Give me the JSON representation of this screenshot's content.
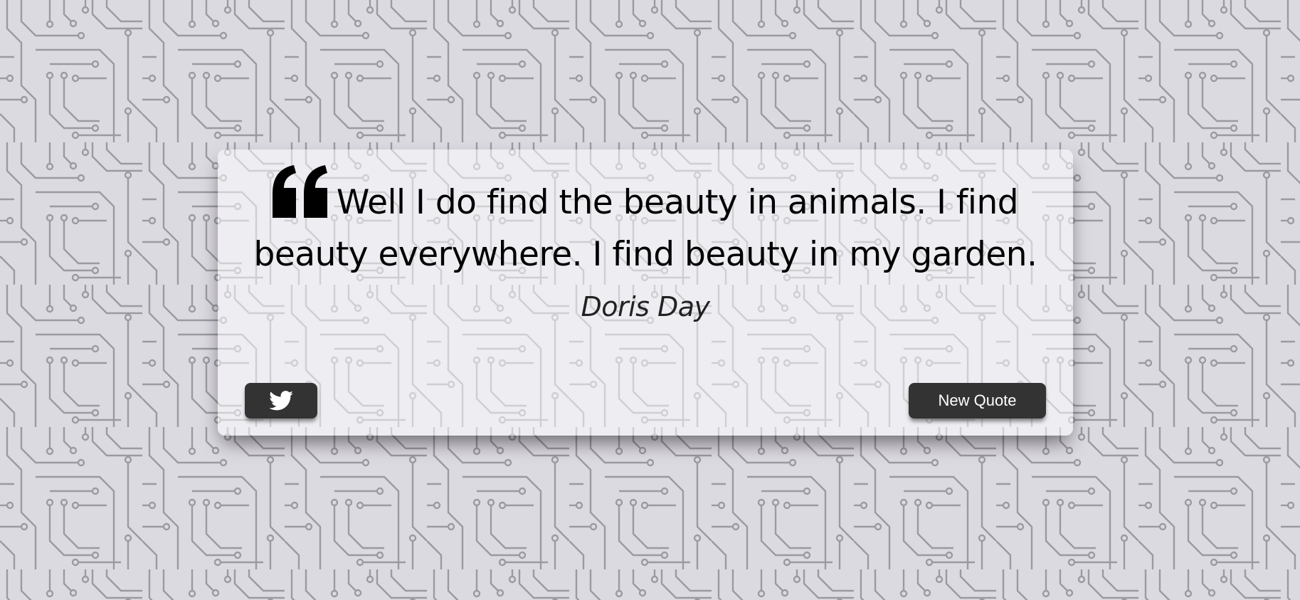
{
  "quote": {
    "text": "Well I do find the beauty in animals. I find beauty everywhere. I find beauty in my garden.",
    "author": "Doris Day"
  },
  "actions": {
    "new_quote_label": "New Quote"
  },
  "icons": {
    "quote_mark": "quote-left-icon",
    "tweet": "twitter-bird-icon"
  },
  "colors": {
    "background": "#dcdae1",
    "circuit_lines": "#9b9aa1",
    "button": "#333333",
    "button_text": "#ffffff",
    "text": "#000000"
  }
}
